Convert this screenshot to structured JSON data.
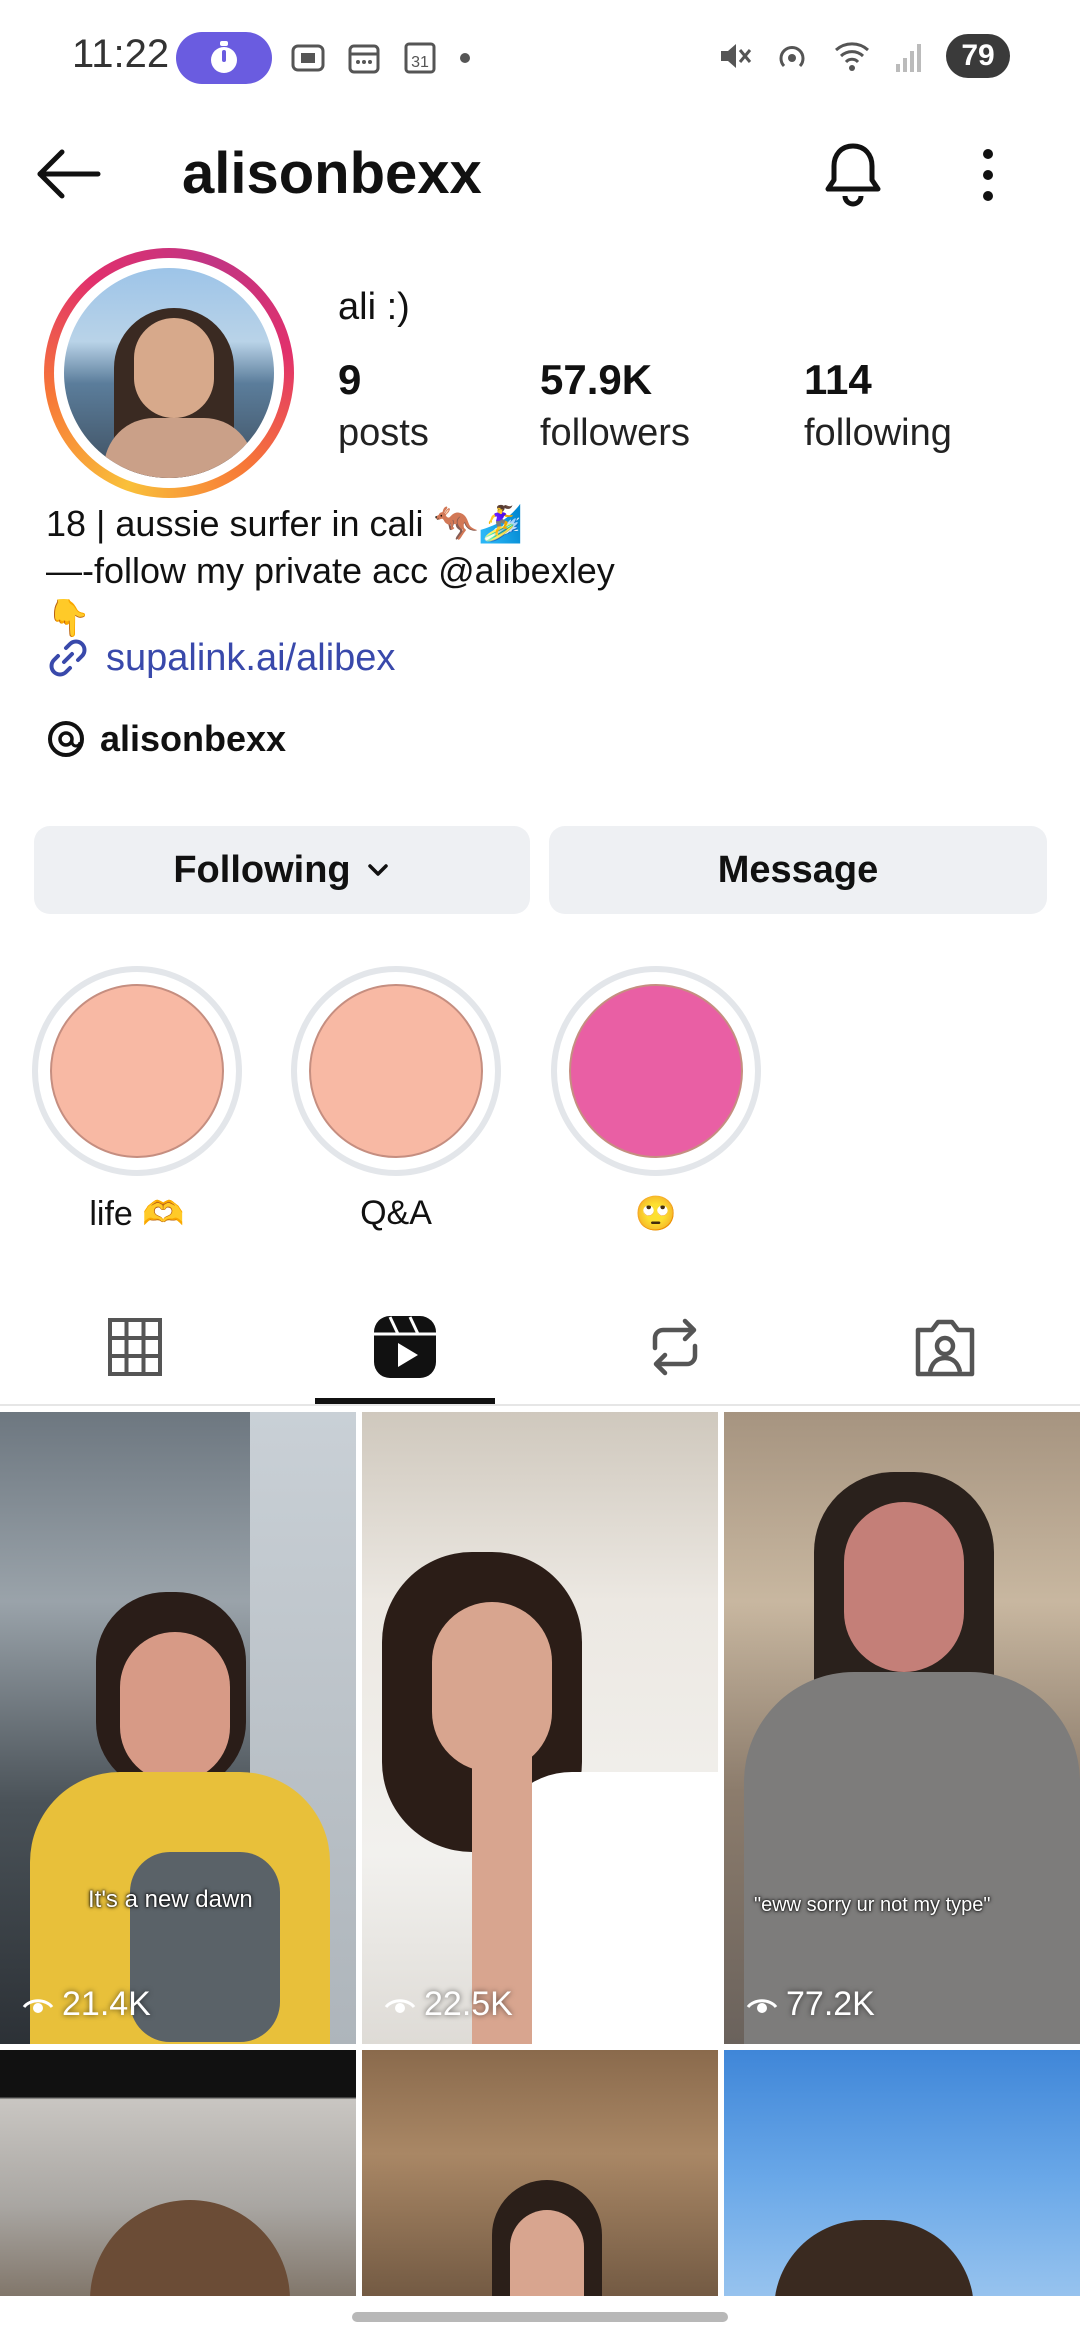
{
  "status_bar": {
    "time": "11:22",
    "battery": "79"
  },
  "header": {
    "username": "alisonbexx"
  },
  "profile": {
    "display_name": "ali :)",
    "stats": [
      {
        "value": "9",
        "label": "posts"
      },
      {
        "value": "57.9K",
        "label": "followers"
      },
      {
        "value": "114",
        "label": "following"
      }
    ],
    "bio_lines": [
      "18 | aussie surfer in cali 🦘🏄‍♀️",
      "—-follow my private acc @alibexley",
      "👇"
    ],
    "link": "supalink.ai/alibex",
    "threads_handle": "alisonbexx"
  },
  "actions": {
    "following_label": "Following",
    "message_label": "Message"
  },
  "highlights": [
    {
      "label": "life 🫶",
      "color": "#f8b9a4"
    },
    {
      "label": "Q&A",
      "color": "#f8b9a4"
    },
    {
      "label": "🙄",
      "color": "#e95fa4"
    }
  ],
  "tabs": [
    {
      "name": "grid-icon"
    },
    {
      "name": "reels-icon",
      "active": true
    },
    {
      "name": "reposts-icon"
    },
    {
      "name": "tagged-icon"
    }
  ],
  "reels": [
    {
      "views": "21.4K",
      "caption": "It's a new dawn"
    },
    {
      "views": "22.5K",
      "caption": ""
    },
    {
      "views": "77.2K",
      "caption": "\"eww sorry ur not my type\""
    }
  ],
  "colors": {
    "link": "#3949ab",
    "button_bg": "#eef0f3",
    "status_pill": "#6a5ce0"
  }
}
